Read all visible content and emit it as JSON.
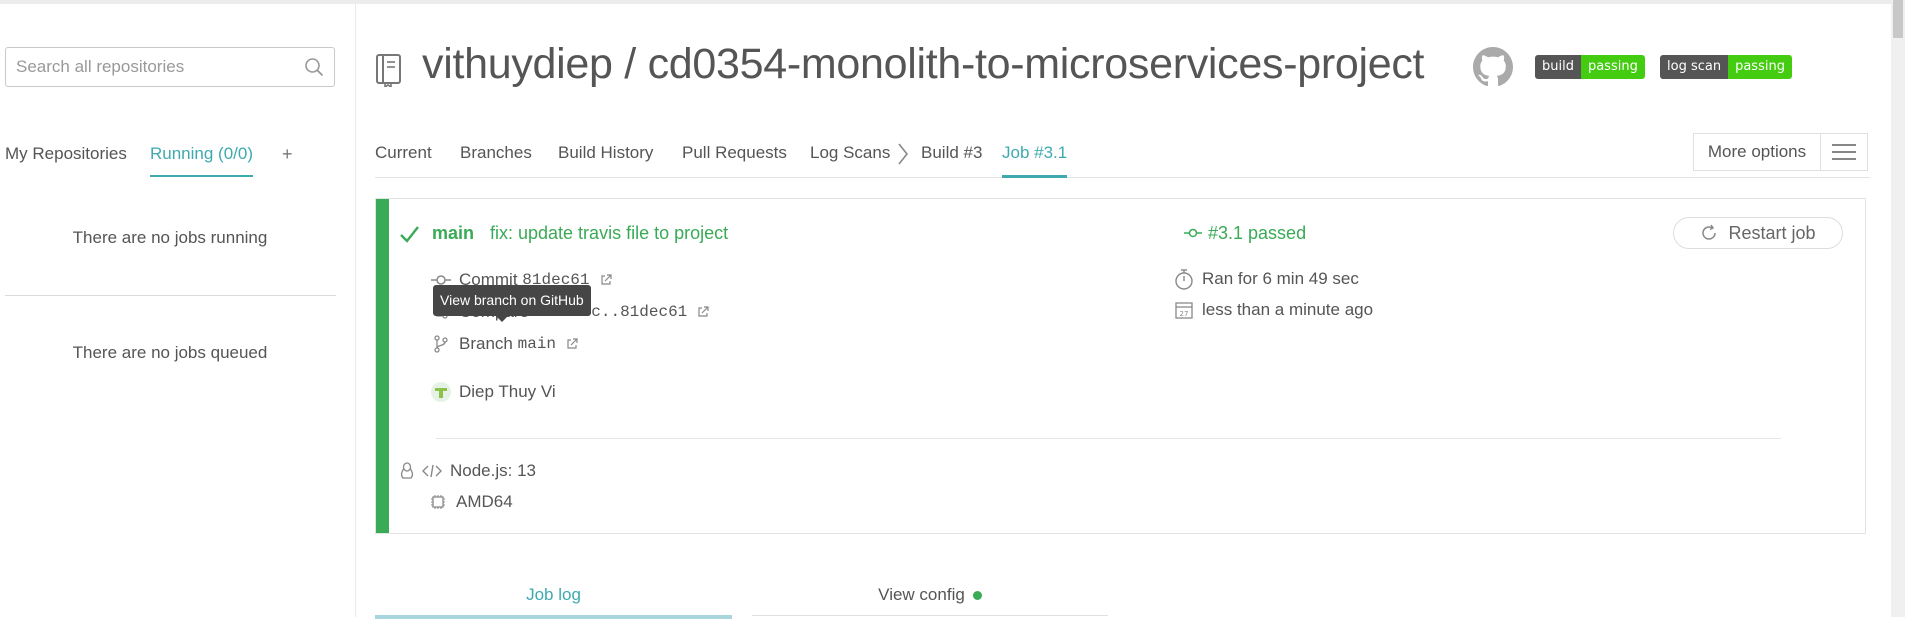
{
  "sidebar": {
    "search_placeholder": "Search all repositories",
    "tabs": {
      "my_repos": "My Repositories",
      "running": "Running (0/0)",
      "plus": "+"
    },
    "no_running": "There are no jobs running",
    "no_queued": "There are no jobs queued"
  },
  "header": {
    "title": "vithuydiep / cd0354-monolith-to-microservices-project",
    "badges": [
      {
        "left": "build",
        "right": "passing"
      },
      {
        "left": "log scan",
        "right": "passing"
      }
    ]
  },
  "tabs": {
    "current": "Current",
    "branches": "Branches",
    "build_history": "Build History",
    "pull_requests": "Pull Requests",
    "log_scans": "Log Scans",
    "build": "Build #3",
    "job": "Job #3.1",
    "more_options": "More options"
  },
  "job": {
    "branch": "main",
    "message": "fix: update travis file to project",
    "commit_label": "Commit",
    "commit_sha": "81dec61",
    "compare_label": "Compare",
    "compare_range": "4ccb53c..81dec61",
    "branch_label": "Branch",
    "branch_value": "main",
    "author": "Diep Thuy Vi",
    "status": "#3.1 passed",
    "restart": "Restart job",
    "duration": "Ran for 6 min 49 sec",
    "finished": "less than a minute ago",
    "language": "Node.js: 13",
    "arch": "AMD64"
  },
  "tooltip": "View branch on GitHub",
  "bottom_tabs": {
    "job_log": "Job log",
    "view_config": "View config"
  },
  "colors": {
    "passed": "#39aa56",
    "accent": "#3eaaaf"
  }
}
